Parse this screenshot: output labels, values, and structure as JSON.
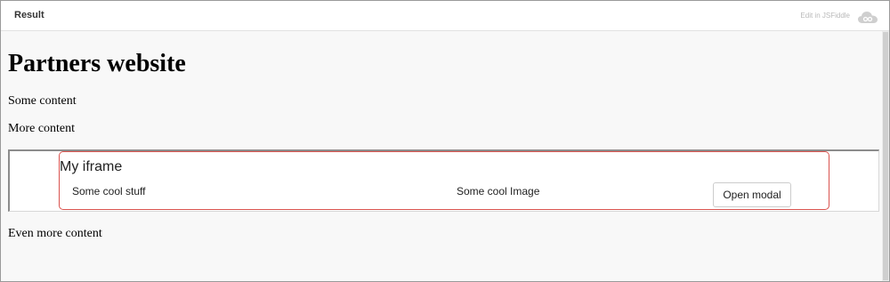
{
  "topbar": {
    "tab_label": "Result",
    "edit_link": "Edit in JSFiddle"
  },
  "page": {
    "title": "Partners website",
    "paragraphs": [
      "Some content",
      "More content",
      "Even more content"
    ]
  },
  "iframe": {
    "title": "My iframe",
    "cells": [
      "Some cool stuff",
      "Some cool Image"
    ],
    "button_label": "Open modal"
  },
  "colors": {
    "accent_border": "#d9534f",
    "page_background": "#f8f8f8"
  }
}
